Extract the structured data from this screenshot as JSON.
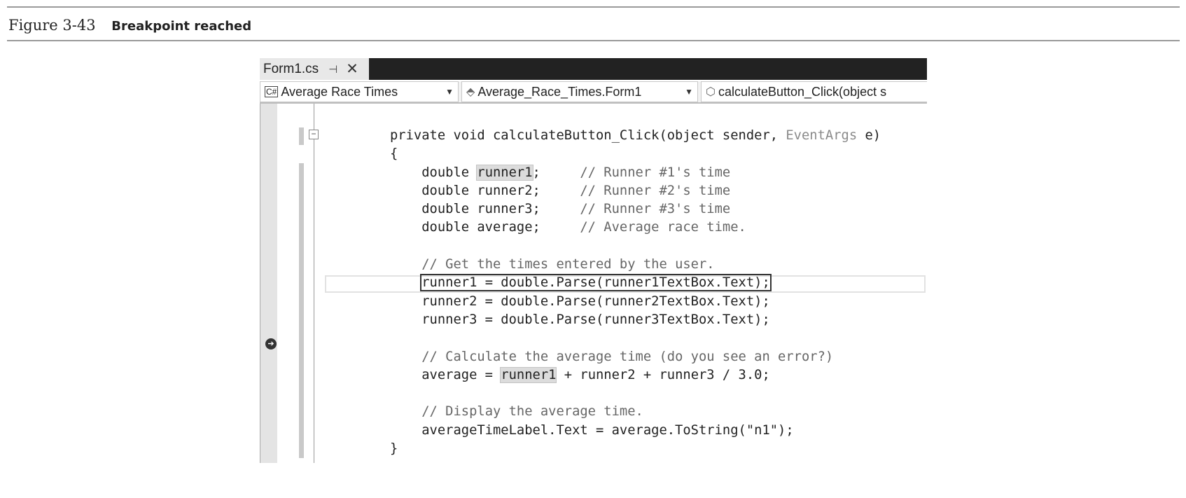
{
  "caption": {
    "number": "Figure 3-43",
    "title": "Breakpoint reached"
  },
  "tab": {
    "label": "Form1.cs",
    "pin_icon": "⊣",
    "close_icon": "✕"
  },
  "nav": {
    "project": "Average Race Times",
    "project_icon": "C#",
    "class": "Average_Race_Times.Form1",
    "class_icon": "⬘",
    "member": "calculateButton_Click(object s",
    "member_icon": "⬡"
  },
  "breakpoint_icon": "➔",
  "code_lines": [
    [
      {
        "t": "private void calculateButton_Click(object sender, "
      },
      {
        "t": "EventArgs",
        "c": "type"
      },
      {
        "t": " e)"
      }
    ],
    [
      {
        "t": "{"
      }
    ],
    [
      {
        "t": "    double "
      },
      {
        "t": "runner1",
        "c": "hl"
      },
      {
        "t": ";     "
      },
      {
        "t": "// Runner #1's time",
        "c": "comment"
      }
    ],
    [
      {
        "t": "    double runner2;     "
      },
      {
        "t": "// Runner #2's time",
        "c": "comment"
      }
    ],
    [
      {
        "t": "    double runner3;     "
      },
      {
        "t": "// Runner #3's time",
        "c": "comment"
      }
    ],
    [
      {
        "t": "    double average;     "
      },
      {
        "t": "// Average race time.",
        "c": "comment"
      }
    ],
    [
      {
        "t": ""
      }
    ],
    [
      {
        "t": "    "
      },
      {
        "t": "// Get the times entered by the user.",
        "c": "comment"
      }
    ],
    [
      {
        "t": "    "
      },
      {
        "t": "runner1 = double.Parse(runner1TextBox.Text);",
        "c": "stmt"
      }
    ],
    [
      {
        "t": "    runner2 = double.Parse(runner2TextBox.Text);"
      }
    ],
    [
      {
        "t": "    runner3 = double.Parse(runner3TextBox.Text);"
      }
    ],
    [
      {
        "t": ""
      }
    ],
    [
      {
        "t": "    "
      },
      {
        "t": "// Calculate the average time (do you see an error?)",
        "c": "comment"
      }
    ],
    [
      {
        "t": "    average = "
      },
      {
        "t": "runner1",
        "c": "hl"
      },
      {
        "t": " + runner2 + runner3 / 3.0;"
      }
    ],
    [
      {
        "t": ""
      }
    ],
    [
      {
        "t": "    "
      },
      {
        "t": "// Display the average time.",
        "c": "comment"
      }
    ],
    [
      {
        "t": "    averageTimeLabel.Text = average.ToString(\"n1\");"
      }
    ],
    [
      {
        "t": "}"
      }
    ]
  ]
}
